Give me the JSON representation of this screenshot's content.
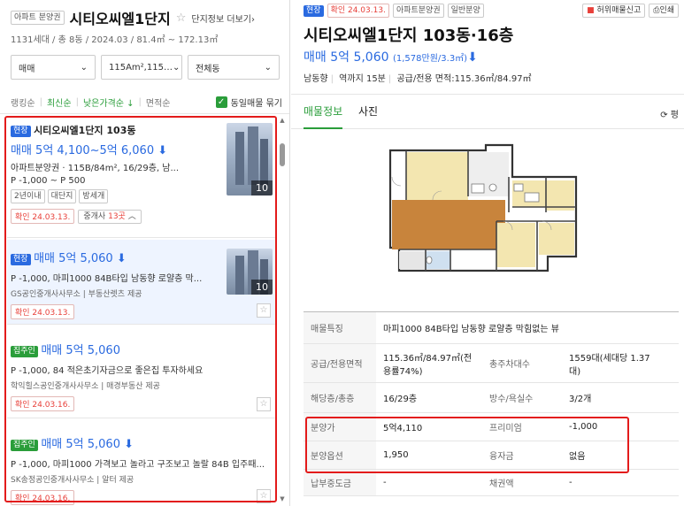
{
  "left": {
    "header": {
      "tag": "아파트 분양권",
      "title": "시티오씨엘1단지",
      "star": "☆",
      "more": "단지정보 더보기",
      "more_arrow": "›",
      "sub": "1131세대 / 총 8동 / 2024.03 / 81.4㎡ ~ 172.13㎡"
    },
    "filters": {
      "trade": "매매",
      "area": "115Am²,115…",
      "dong": "전체동",
      "chevron": "⌄"
    },
    "sort": {
      "items": [
        "랭킹순",
        "최신순",
        "낮은가격순 ↓",
        "면적순"
      ],
      "same_listing": "동일매물 묶기"
    },
    "items": [
      {
        "badge": "현장",
        "title": "시티오씨엘1단지 103동",
        "price": "매매 5억 4,100~5억 6,060",
        "arrow": "⬇",
        "desc": "아파트분양권 · 115B/84m², 16/29층, 남...",
        "premium": "P -1,000 ~ P 500",
        "tags": [
          "2년이내",
          "대단지",
          "방세개"
        ],
        "confirm": "확인 24.03.13.",
        "agents_label": "중개사",
        "agents_count": "13곳",
        "agents_chevron": "︿",
        "photo_count": "10"
      },
      {
        "badge": "현장",
        "price": "매매 5억 5,060",
        "arrow": "⬇",
        "desc": "P -1,000, 마피1000 84B타입 남동향 로얄층 막...",
        "agent": "GS공인중개사사무소 | 부동산렛츠 제공",
        "confirm": "확인 24.03.13.",
        "photo_count": "10"
      },
      {
        "badge": "집주인",
        "price": "매매 5억 5,060",
        "desc": "P -1,000, 84 적은초기자금으로 좋은집 투자하세요",
        "agent": "학익힐스공인중개사사무소 | 매경부동산 제공",
        "confirm": "확인 24.03.16."
      },
      {
        "badge": "집주인",
        "price": "매매 5억 5,060",
        "arrow": "⬇",
        "desc": "P -1,000, 마피1000 가격보고 놀라고 구조보고 놀랄 84B 입주때...",
        "agent": "SK송정공인중개사사무소 | 알터 제공",
        "confirm": "확인 24.03.16."
      }
    ]
  },
  "right": {
    "tags": [
      "현장",
      "확인 24.03.13.",
      "아파트분양권",
      "일반분양"
    ],
    "report_btn": "허위매물신고",
    "print_btn": "인쇄",
    "title": "시티오씨엘1단지 103동·16층",
    "price": "매매 5억 5,060",
    "unit_price": "(1,578만원/3.3㎡)",
    "arrow": "⬇",
    "info": [
      "남동향",
      "역까지 15분",
      "공급/전용 면적:115.36㎡/84.97㎡"
    ],
    "tabs": [
      "매물정보",
      "사진"
    ],
    "refresh": "⟳ 평",
    "table": {
      "feature_label": "매물특징",
      "feature": "마피1000 84B타입 남동향 로얄층 막힘없는 뷰",
      "area_label": "공급/전용면적",
      "area": "115.36㎡/84.97㎡(전용률74%)",
      "parking_label": "총주차대수",
      "parking": "1559대(세대당 1.37대)",
      "floor_label": "해당층/총층",
      "floor": "16/29층",
      "rooms_label": "방수/욕실수",
      "rooms": "3/2개",
      "sale_label": "분양가",
      "sale": "5억4,110",
      "premium_label": "프리미엄",
      "premium": "-1,000",
      "option_label": "분양옵션",
      "option": "1,950",
      "loan_label": "융자금",
      "loan": "없음",
      "paid_label": "납부중도금",
      "paid": "-",
      "bond_label": "채권액",
      "bond": "-"
    }
  },
  "colors": {
    "accent_blue": "#2a6ae0",
    "accent_green": "#2a9d3a",
    "highlight_red": "#e31b1b"
  }
}
